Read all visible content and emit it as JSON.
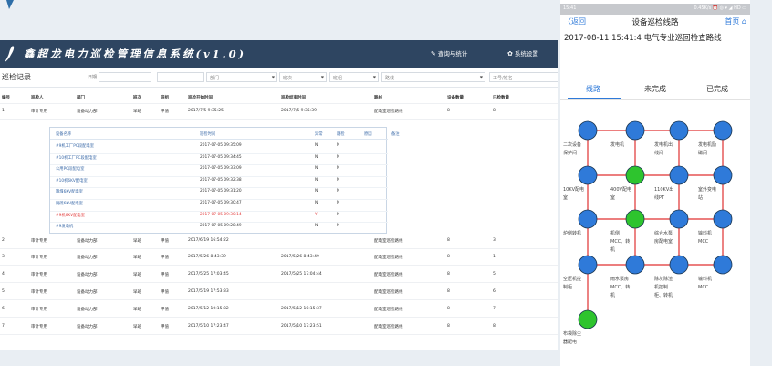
{
  "app": {
    "title": "鑫超龙电力巡检管理信息系统(v1.0)",
    "nav_stats": "查询与统计",
    "nav_settings": "系统设置"
  },
  "filters": {
    "section_title": "巡检记录",
    "date_label": "日期",
    "dept_placeholder": "部门",
    "shift_placeholder": "班次",
    "team_placeholder": "班组",
    "route_placeholder": "路线",
    "worker_placeholder": "工号/姓名"
  },
  "table": {
    "headers": [
      "编号",
      "巡检人",
      "部门",
      "班次",
      "班组",
      "巡检开始时间",
      "巡检结束时间",
      "路线",
      "设备数量",
      "已检数量"
    ],
    "rows": [
      {
        "id": "1",
        "person": "审计专用",
        "dept": "设备动力部",
        "shift": "早班",
        "team": "甲值",
        "start": "2017/7/5 9:35:25",
        "end": "2017/7/5 9:35:39",
        "route": "配电室巡检路线",
        "count": "8",
        "checked": "8"
      },
      {
        "id": "2",
        "person": "审计专用",
        "dept": "设备动力部",
        "shift": "早班",
        "team": "甲值",
        "start": "2017/6/19 16:54:22",
        "end": "",
        "route": "配电室巡检路线",
        "count": "8",
        "checked": "3"
      },
      {
        "id": "3",
        "person": "审计专用",
        "dept": "设备动力部",
        "shift": "早班",
        "team": "甲值",
        "start": "2017/5/26 8:43:39",
        "end": "2017/5/26 8:43:49",
        "route": "配电室巡检路线",
        "count": "8",
        "checked": "1"
      },
      {
        "id": "4",
        "person": "审计专用",
        "dept": "设备动力部",
        "shift": "早班",
        "team": "甲值",
        "start": "2017/5/25 17:03:45",
        "end": "2017/5/25 17:04:44",
        "route": "配电室巡检路线",
        "count": "8",
        "checked": "5"
      },
      {
        "id": "5",
        "person": "审计专用",
        "dept": "设备动力部",
        "shift": "早班",
        "team": "甲值",
        "start": "2017/5/19 17:53:33",
        "end": "",
        "route": "配电室巡检路线",
        "count": "8",
        "checked": "6"
      },
      {
        "id": "6",
        "person": "审计专用",
        "dept": "设备动力部",
        "shift": "早班",
        "team": "甲值",
        "start": "2017/5/12 10:15:32",
        "end": "2017/5/12 10:15:37",
        "route": "配电室巡检路线",
        "count": "8",
        "checked": "7"
      },
      {
        "id": "7",
        "person": "审计专用",
        "dept": "设备动力部",
        "shift": "早班",
        "team": "甲值",
        "start": "2017/5/10 17:23:47",
        "end": "2017/5/10 17:23:51",
        "route": "配电室巡检路线",
        "count": "8",
        "checked": "8"
      }
    ]
  },
  "detail": {
    "headers": [
      "设备名称",
      "巡检时间",
      "异常",
      "跳检",
      "原因",
      "备注"
    ],
    "rows": [
      {
        "name": "#9机工厂PC段配电室",
        "time": "2017-07-05 09:35:09",
        "abnormal": "N",
        "skip": "N",
        "alert": false
      },
      {
        "name": "#10机工厂PC段配电室",
        "time": "2017-07-05 09:34:45",
        "abnormal": "N",
        "skip": "N",
        "alert": false
      },
      {
        "name": "公用PC段配电室",
        "time": "2017-07-05 09:33:09",
        "abnormal": "N",
        "skip": "N",
        "alert": false
      },
      {
        "name": "#10机6KV配电室",
        "time": "2017-07-05 09:32:38",
        "abnormal": "N",
        "skip": "N",
        "alert": false
      },
      {
        "name": "输煤6KV配电室",
        "time": "2017-07-05 09:31:20",
        "abnormal": "N",
        "skip": "N",
        "alert": false
      },
      {
        "name": "脱硫6KV配电室",
        "time": "2017-07-05 09:30:47",
        "abnormal": "N",
        "skip": "N",
        "alert": false
      },
      {
        "name": "#9机6KV配电室",
        "time": "2017-07-05 09:30:14",
        "abnormal": "Y",
        "skip": "N",
        "alert": true
      },
      {
        "name": "#9发电机",
        "time": "2017-07-05 09:28:49",
        "abnormal": "N",
        "skip": "N",
        "alert": false
      }
    ]
  },
  "phone": {
    "status_time": "15:41",
    "status_icons": "0.45K/s ⏰ ◎ ▾ ◢ HD ▭",
    "back_label": "〈返回",
    "nav_title": "设备巡检线路",
    "home_label": "首页",
    "subtitle": "2017-08-11 15:41:4 电气专业巡回检查路线",
    "tabs": [
      {
        "label": "线路",
        "active": true
      },
      {
        "label": "未完成",
        "active": false
      },
      {
        "label": "已完成",
        "active": false
      }
    ],
    "nodes": [
      {
        "label": "二次设备保护间",
        "status": "pending"
      },
      {
        "label": "发电机",
        "status": "pending"
      },
      {
        "label": "发电机出线间",
        "status": "pending"
      },
      {
        "label": "发电机励磁间",
        "status": "pending"
      },
      {
        "label": "10KV配电室",
        "status": "pending"
      },
      {
        "label": "400V配电室",
        "status": "done"
      },
      {
        "label": "110KV出线PT",
        "status": "pending"
      },
      {
        "label": "室外变电站",
        "status": "pending"
      },
      {
        "label": "炉侧转机",
        "status": "pending"
      },
      {
        "label": "机侧MCC、转机",
        "status": "done"
      },
      {
        "label": "综合水泵房配电室",
        "status": "pending"
      },
      {
        "label": "输料机MCC",
        "status": "pending"
      },
      {
        "label": "空压机控制柜",
        "status": "pending"
      },
      {
        "label": "雨水泵房MCC、转机",
        "status": "pending"
      },
      {
        "label": "除灰除渣机控制柜、转机",
        "status": "pending"
      },
      {
        "label": "输料机MCC",
        "status": "pending"
      },
      {
        "label": "布袋除尘器配电",
        "status": "done"
      }
    ]
  },
  "colors": {
    "topbar": "#2e4561",
    "accent": "#2f7ad9",
    "node_pending": "#2f7ad9",
    "node_done": "#2ec42e",
    "route_line": "#e03131",
    "alert_text": "#e23b3b"
  }
}
